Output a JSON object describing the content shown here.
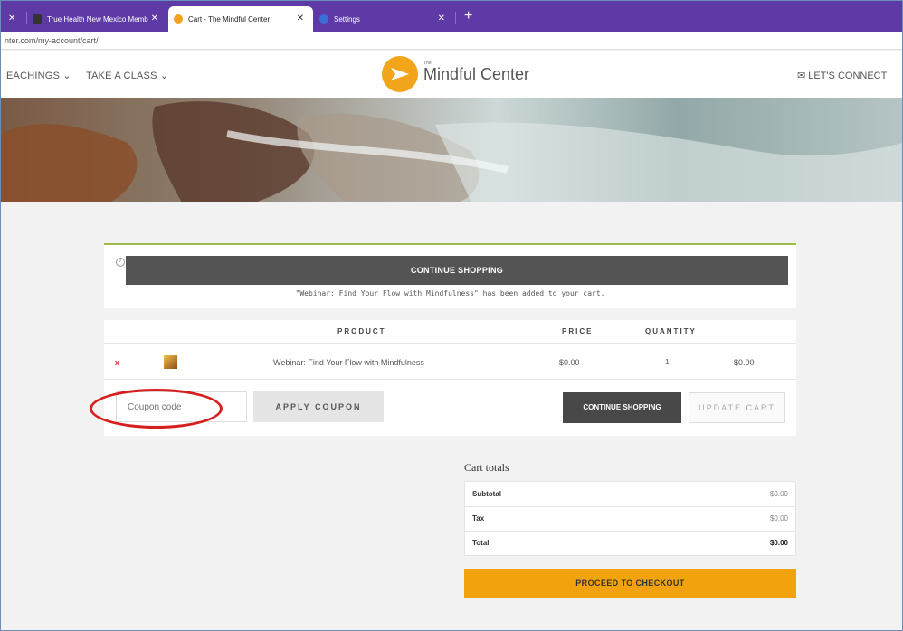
{
  "browser": {
    "tabs": [
      {
        "label": "True Health New Mexico Memb",
        "active": false
      },
      {
        "label": "Cart - The Mindful Center",
        "active": true
      },
      {
        "label": "Settings",
        "active": false
      }
    ],
    "url": "nter.com/my-account/cart/"
  },
  "header": {
    "nav": [
      "EACHINGS",
      "TAKE A CLASS"
    ],
    "logo_small": "The",
    "logo_text": "Mindful Center",
    "connect": "LET'S CONNECT",
    "brand_color": "#f2a51a"
  },
  "notice": {
    "button": "CONTINUE SHOPPING",
    "message": "\"Webinar: Find Your Flow with Mindfulness\" has been added to your cart.",
    "accent": "#9fbb4a"
  },
  "cart": {
    "headers": {
      "product": "PRODUCT",
      "price": "PRICE",
      "quantity": "QUANTITY"
    },
    "item": {
      "remove": "x",
      "name": "Webinar: Find Your Flow with Mindfulness",
      "price": "$0.00",
      "quantity": "1",
      "subtotal": "$0.00"
    },
    "coupon_placeholder": "Coupon code",
    "apply_coupon": "APPLY COUPON",
    "continue_shopping": "CONTINUE SHOPPING",
    "update_cart": "UPDATE CART"
  },
  "totals": {
    "title": "Cart totals",
    "rows": [
      {
        "label": "Subtotal",
        "value": "$0.00"
      },
      {
        "label": "Tax",
        "value": "$0.00"
      },
      {
        "label": "Total",
        "value": "$0.00"
      }
    ],
    "checkout": "PROCEED TO CHECKOUT",
    "checkout_color": "#f2a20d"
  },
  "annotation_color": "#d81f1f"
}
